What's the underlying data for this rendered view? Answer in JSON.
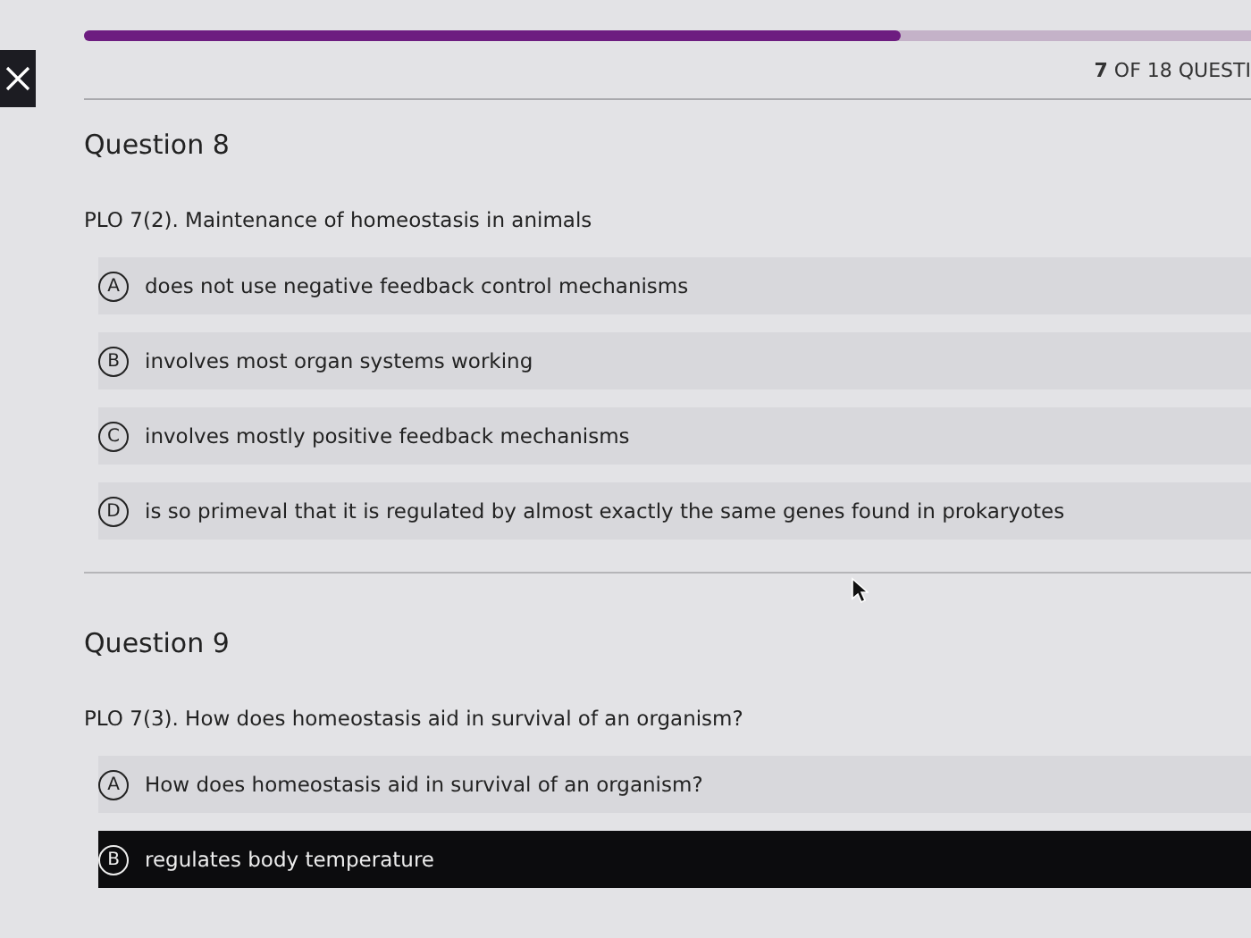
{
  "progress": {
    "level": 0.7,
    "counter": "**7** OF 18 QUESTI"
  },
  "questions": [
    {
      "title": "Question 8",
      "prompt": "PLO 7(2). Maintenance of homeostasis in animals",
      "options": [
        {
          "letter": "A",
          "text": "does not use negative feedback control mechanisms",
          "selected": false
        },
        {
          "letter": "B",
          "text": "involves most organ systems working",
          "selected": false
        },
        {
          "letter": "C",
          "text": "involves mostly positive feedback mechanisms",
          "selected": false
        },
        {
          "letter": "D",
          "text": "is so primeval that it is regulated by almost exactly the same genes found in prokaryotes",
          "selected": false
        }
      ]
    },
    {
      "title": "Question 9",
      "prompt": "PLO 7(3). How does homeostasis aid in survival of an organism?",
      "options": [
        {
          "letter": "A",
          "text": "How does homeostasis aid in survival of an organism?",
          "selected": false
        },
        {
          "letter": "B",
          "text": "regulates body temperature",
          "selected": true
        }
      ]
    }
  ]
}
